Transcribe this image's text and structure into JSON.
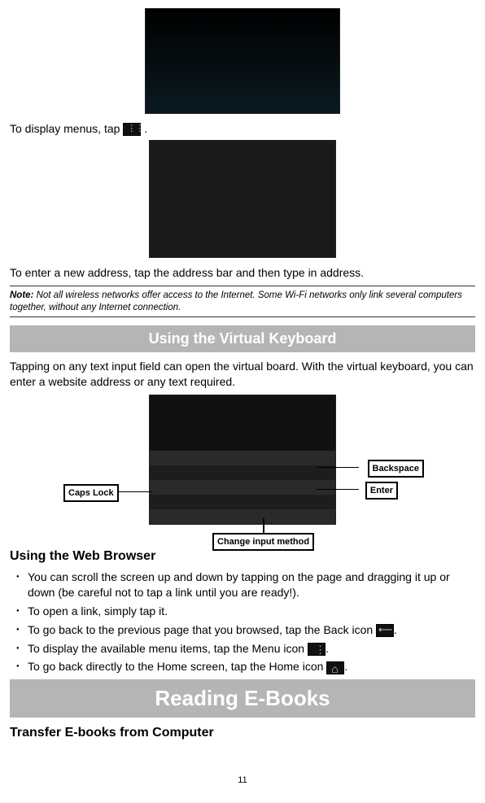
{
  "text": {
    "display_menus": "To display menus, tap",
    "display_menus_period": ".",
    "enter_address": "To enter a new address, tap the address bar and then type in address.",
    "note_label": "Note:",
    "note_body": " Not all wireless networks offer access to the Internet. Some Wi-Fi networks only link several computers together, without any Internet connection.",
    "heading_keyboard": "Using the Virtual Keyboard",
    "tapping_text": "Tapping on any text input field can open the virtual board. With the virtual keyboard, you can enter a website address or any text required.",
    "label_caps": "Caps Lock",
    "label_backspace": "Backspace",
    "label_enter": "Enter",
    "label_change": "Change input method",
    "heading_browser": "Using the Web Browser",
    "li_scroll": "You can scroll the screen up and down by tapping on the page and dragging it up or down (be careful not to tap a link until you are ready!).",
    "li_open": "To open a link, simply tap it.",
    "li_back": "To go back to the previous page that you browsed, tap the Back icon",
    "li_back_period": ".",
    "li_menu": "To display the available menu items, tap the Menu icon",
    "li_menu_period": ".",
    "li_home": "To go back directly to the Home screen, tap the Home icon",
    "li_home_period": ".",
    "heading_ebooks": "Reading E-Books",
    "heading_transfer": "Transfer E-books from Computer",
    "page_number": "11"
  }
}
